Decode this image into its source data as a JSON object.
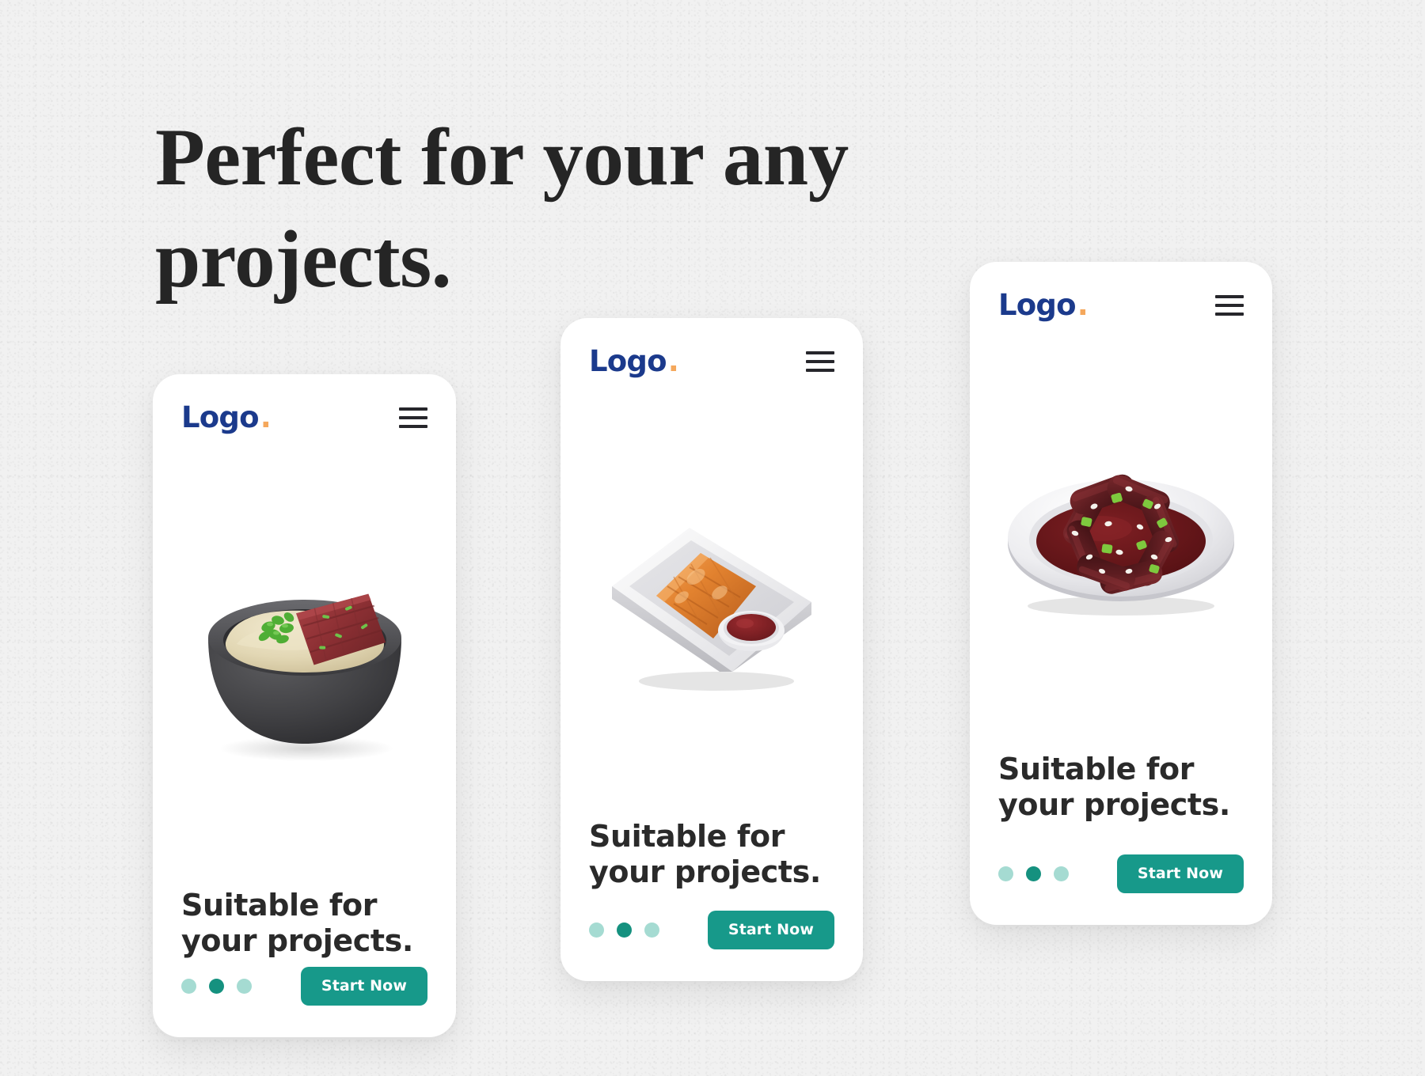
{
  "page": {
    "headline": "Perfect for your any\nprojects.",
    "background_color": "#f1f1f1",
    "accent_blue": "#1b3a8c",
    "accent_orange": "#f5a85c",
    "accent_teal": "#17998a",
    "dot_inactive": "#a5dbd2",
    "dot_active": "#15917f"
  },
  "cards": [
    {
      "logo_text": "Logo",
      "logo_dot": ".",
      "menu_icon": "hamburger-menu-icon",
      "image_alt": "3d-bowl-with-mashed-potato-and-beef-rib",
      "headline": "Suitable for\nyour projects.",
      "dots": {
        "count": 3,
        "active_index": 1
      },
      "cta_label": "Start Now"
    },
    {
      "logo_text": "Logo",
      "logo_dot": ".",
      "menu_icon": "hamburger-menu-icon",
      "image_alt": "3d-tray-with-bread-roll-and-dipping-sauce",
      "headline": "Suitable for\nyour projects.",
      "dots": {
        "count": 3,
        "active_index": 1
      },
      "cta_label": "Start Now"
    },
    {
      "logo_text": "Logo",
      "logo_dot": ".",
      "menu_icon": "hamburger-menu-icon",
      "image_alt": "3d-plate-of-braised-meat-with-sauce-scallions-and-sesame",
      "headline": "Suitable for\nyour projects.",
      "dots": {
        "count": 3,
        "active_index": 1
      },
      "cta_label": "Start Now"
    }
  ]
}
